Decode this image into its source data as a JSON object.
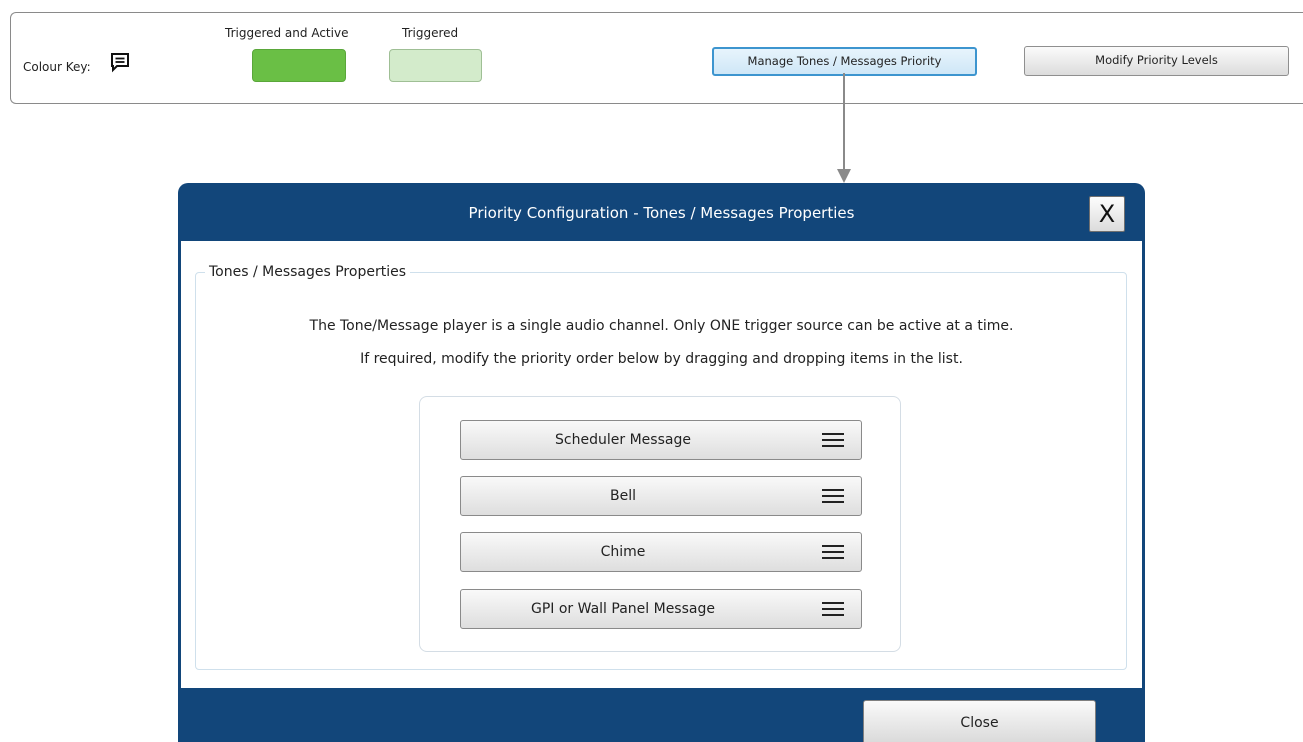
{
  "colour_key": {
    "label": "Colour Key:",
    "icon": "message-icon",
    "triggered_and_active": {
      "caption": "Triggered and Active",
      "color": "#6abf45"
    },
    "triggered": {
      "caption": "Triggered",
      "color": "#d3ebcb"
    }
  },
  "toolbar": {
    "manage_label": "Manage Tones / Messages Priority",
    "modify_label": "Modify Priority Levels"
  },
  "dialog": {
    "title": "Priority Configuration - Tones / Messages Properties",
    "close_x": "X",
    "legend": "Tones / Messages Properties",
    "description_line1": "The Tone/Message player is a single audio channel. Only ONE trigger source can be active at a time.",
    "description_line2": "If required, modify the priority order below by dragging and dropping items in the list.",
    "priority_items": [
      {
        "label": "Scheduler Message",
        "icon": "drag-handle-icon"
      },
      {
        "label": "Bell",
        "icon": "drag-handle-icon"
      },
      {
        "label": "Chime",
        "icon": "drag-handle-icon"
      },
      {
        "label": "GPI or Wall Panel Message",
        "icon": "drag-handle-icon"
      }
    ],
    "close_button": "Close",
    "header_color": "#12467a"
  },
  "accent_color": "#3d95cf"
}
